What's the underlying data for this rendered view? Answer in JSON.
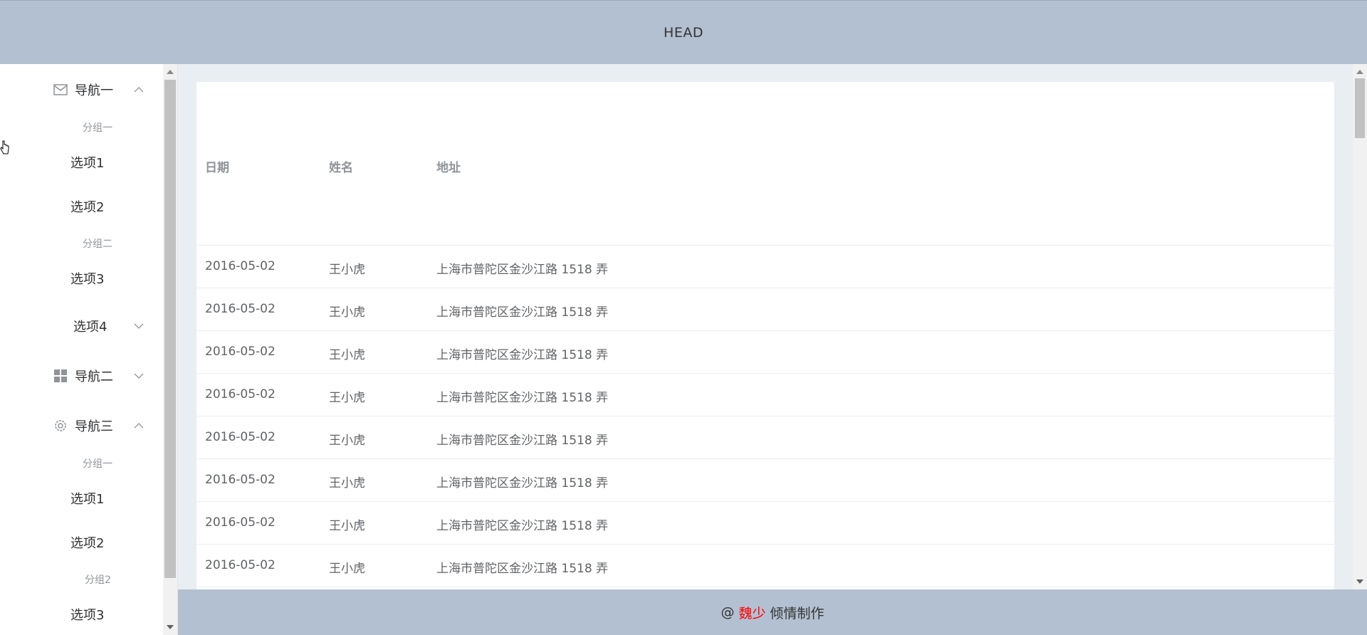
{
  "header": {
    "title": "HEAD"
  },
  "sidebar": {
    "menus": [
      {
        "label": "导航一",
        "icon": "mail-icon",
        "expanded": true
      },
      {
        "label": "导航二",
        "icon": "grid-icon",
        "expanded": false
      },
      {
        "label": "导航三",
        "icon": "gear-icon",
        "expanded": true
      }
    ],
    "nav1": {
      "group1": "分组一",
      "option1": "选项1",
      "option2": "选项2",
      "group2": "分组二",
      "option3": "选项3",
      "option4": "选项4"
    },
    "nav3": {
      "group1": "分组一",
      "option1": "选项1",
      "option2": "选项2",
      "group2": "分组2",
      "option3": "选项3"
    }
  },
  "table": {
    "headers": [
      "日期",
      "姓名",
      "地址"
    ],
    "rows": [
      {
        "date": "2016-05-02",
        "name": "王小虎",
        "address": "上海市普陀区金沙江路 1518 弄"
      },
      {
        "date": "2016-05-02",
        "name": "王小虎",
        "address": "上海市普陀区金沙江路 1518 弄"
      },
      {
        "date": "2016-05-02",
        "name": "王小虎",
        "address": "上海市普陀区金沙江路 1518 弄"
      },
      {
        "date": "2016-05-02",
        "name": "王小虎",
        "address": "上海市普陀区金沙江路 1518 弄"
      },
      {
        "date": "2016-05-02",
        "name": "王小虎",
        "address": "上海市普陀区金沙江路 1518 弄"
      },
      {
        "date": "2016-05-02",
        "name": "王小虎",
        "address": "上海市普陀区金沙江路 1518 弄"
      },
      {
        "date": "2016-05-02",
        "name": "王小虎",
        "address": "上海市普陀区金沙江路 1518 弄"
      },
      {
        "date": "2016-05-02",
        "name": "王小虎",
        "address": "上海市普陀区金沙江路 1518 弄"
      }
    ]
  },
  "footer": {
    "prefix": "@",
    "author": "魏少",
    "suffix": "倾情制作"
  },
  "colors": {
    "header_bg": "#b3c0d1",
    "main_bg": "#e9eef3",
    "author": "#ff0000"
  }
}
